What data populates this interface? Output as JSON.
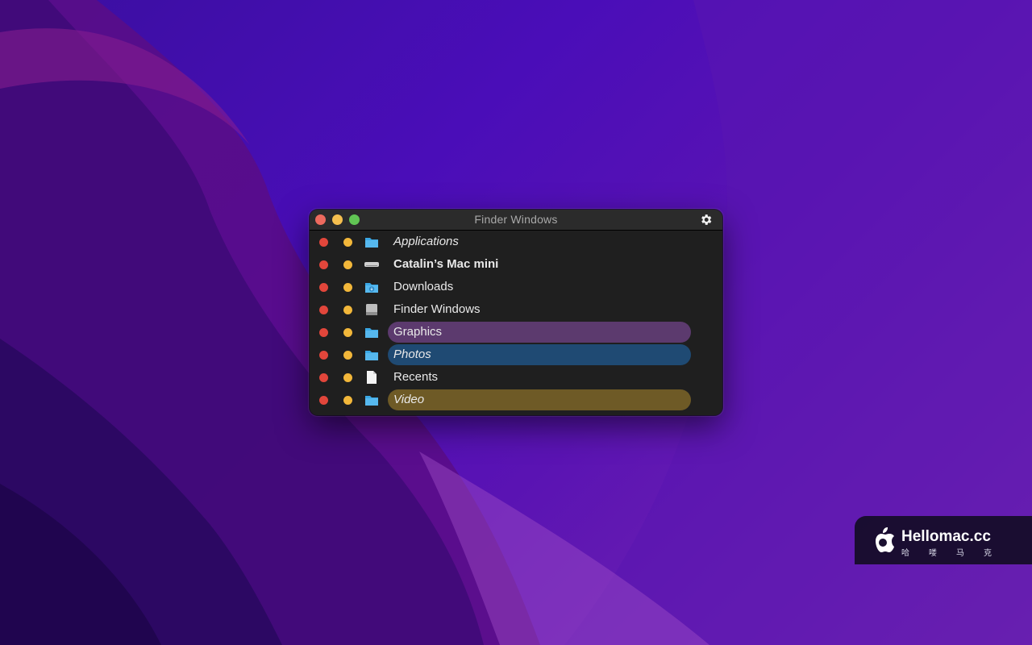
{
  "window": {
    "title": "Finder Windows",
    "items": [
      {
        "label": "Applications",
        "icon": "folder-icon",
        "style": "italic",
        "highlight": null
      },
      {
        "label": "Catalin’s Mac mini",
        "icon": "computer-icon",
        "style": "bold",
        "highlight": null
      },
      {
        "label": "Downloads",
        "icon": "downloads-folder-icon",
        "style": "normal",
        "highlight": null
      },
      {
        "label": "Finder Windows",
        "icon": "disk-icon",
        "style": "normal",
        "highlight": null
      },
      {
        "label": "Graphics",
        "icon": "folder-icon",
        "style": "normal",
        "highlight": "#5c3a6e"
      },
      {
        "label": "Photos",
        "icon": "folder-icon",
        "style": "italic",
        "highlight": "#1f4a73"
      },
      {
        "label": "Recents",
        "icon": "document-icon",
        "style": "normal",
        "highlight": null
      },
      {
        "label": "Video",
        "icon": "folder-icon",
        "style": "italic",
        "highlight": "#6e5a26"
      }
    ]
  },
  "watermark": {
    "name": "Hellomac.cc",
    "subtitle": "哈喽马克"
  },
  "colors": {
    "close": "#ed6a5e",
    "minimize": "#f5bf4f",
    "zoom": "#61c554",
    "folder": "#3aa7e4"
  }
}
